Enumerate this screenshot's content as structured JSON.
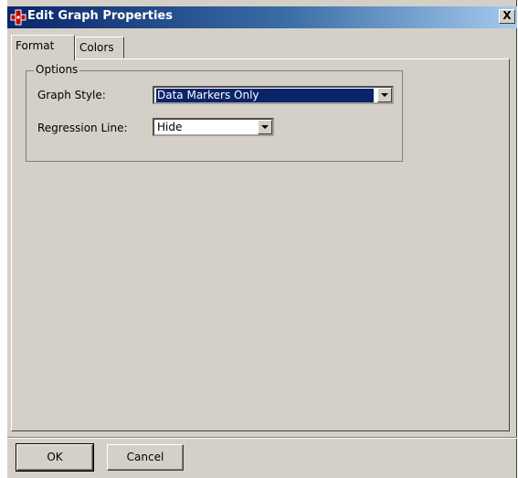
{
  "window": {
    "title": "Edit Graph Properties",
    "close_label": "X",
    "app_icon": "red-puzzle-icon",
    "colors": {
      "titlebar_start": "#0a246a",
      "titlebar_end": "#a6caf0",
      "face": "#d4d0c8",
      "selection": "#0a246a"
    }
  },
  "tabs": [
    {
      "label": "Format",
      "active": true
    },
    {
      "label": "Colors",
      "active": false
    }
  ],
  "options": {
    "legend": "Options",
    "graph_style": {
      "label": "Graph Style:",
      "value": "Data Markers Only"
    },
    "regression_line": {
      "label": "Regression Line:",
      "value": "Hide"
    }
  },
  "buttons": {
    "ok": "OK",
    "cancel": "Cancel"
  }
}
